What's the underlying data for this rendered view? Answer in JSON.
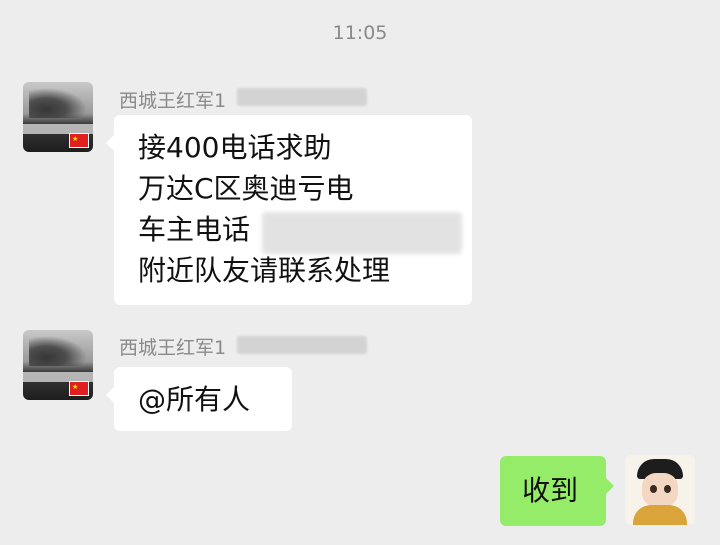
{
  "status": {
    "time": "11:05"
  },
  "messages": [
    {
      "sender": "西城王红军1",
      "lines": [
        "接400电话求助",
        "万达C区奥迪亏电",
        "车主电话",
        "附近队友请联系处理"
      ]
    },
    {
      "sender": "西城王红军1",
      "lines": [
        "@所有人"
      ]
    }
  ],
  "my_message": {
    "text": "收到"
  },
  "icons": {
    "flag": "china-flag-icon",
    "avatar": "avatar-icon"
  }
}
